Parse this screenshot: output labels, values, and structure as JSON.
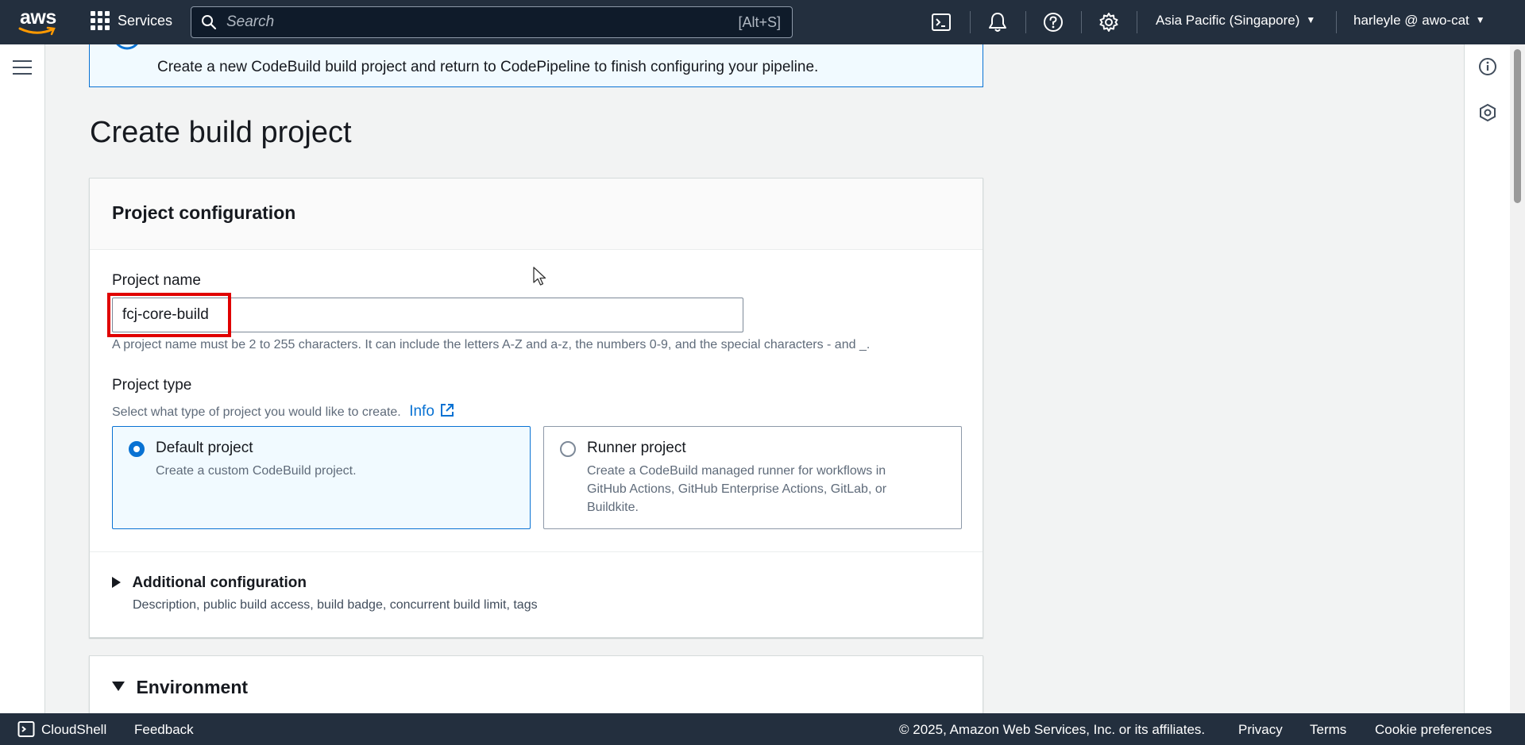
{
  "topnav": {
    "logo_text": "aws",
    "services_label": "Services",
    "search_placeholder": "Search",
    "search_shortcut": "[Alt+S]",
    "region": "Asia Pacific (Singapore)",
    "account": "harleyle @ awo-cat",
    "icons": [
      "cloudshell-icon",
      "bell-icon",
      "help-icon",
      "gear-icon"
    ]
  },
  "flash": {
    "message": "Create a new CodeBuild build project and return to CodePipeline to finish configuring your pipeline."
  },
  "page": {
    "title": "Create build project"
  },
  "project_configuration": {
    "header": "Project configuration",
    "project_name_label": "Project name",
    "project_name_value": "fcj-core-build",
    "project_name_hint": "A project name must be 2 to 255 characters. It can include the letters A-Z and a-z, the numbers 0-9, and the special characters - and _.",
    "project_type_label": "Project type",
    "project_type_hint": "Select what type of project you would like to create.",
    "info_link": "Info",
    "options": [
      {
        "title": "Default project",
        "description": "Create a custom CodeBuild project.",
        "selected": true
      },
      {
        "title": "Runner project",
        "description": "Create a CodeBuild managed runner for workflows in GitHub Actions, GitHub Enterprise Actions, GitLab, or Buildkite.",
        "selected": false
      }
    ],
    "additional_configuration": {
      "title": "Additional configuration",
      "description": "Description, public build access, build badge, concurrent build limit, tags",
      "expanded": false
    }
  },
  "environment": {
    "header": "Environment",
    "expanded": true
  },
  "footer": {
    "cloudshell": "CloudShell",
    "feedback": "Feedback",
    "copyright": "© 2025, Amazon Web Services, Inc. or its affiliates.",
    "privacy": "Privacy",
    "terms": "Terms",
    "cookie_preferences": "Cookie preferences"
  },
  "colors": {
    "nav_bg": "#232f3e",
    "accent": "#0972d3",
    "aws_orange": "#ff9900",
    "highlight": "#e00000"
  }
}
